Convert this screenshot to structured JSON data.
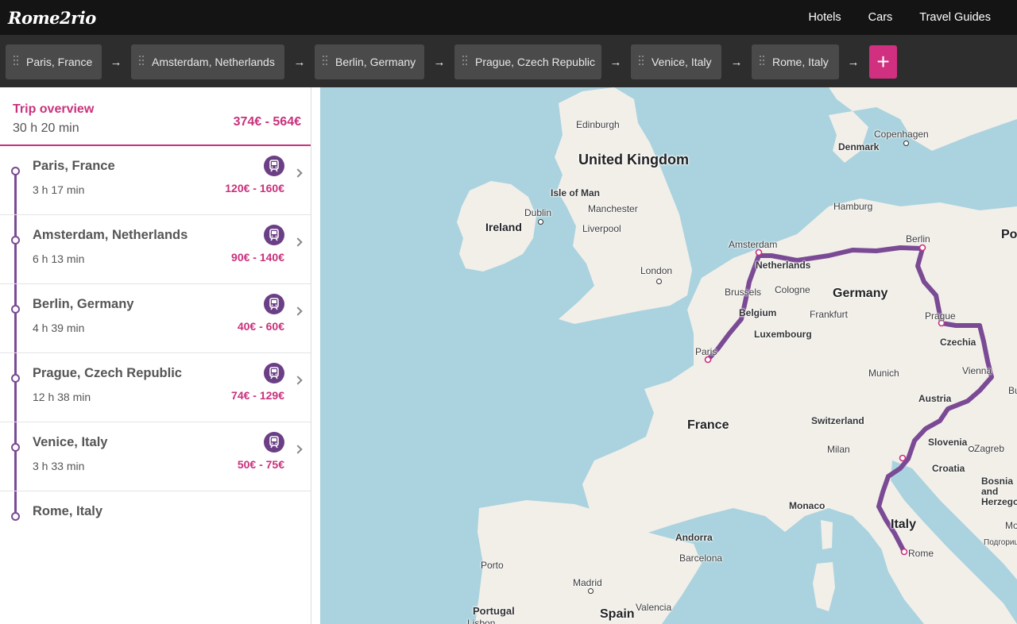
{
  "app": {
    "logo": "Rome2rio"
  },
  "nav": {
    "links": [
      "Hotels",
      "Cars",
      "Travel Guides"
    ]
  },
  "route_bar": {
    "stops": [
      "Paris, France",
      "Amsterdam, Netherlands",
      "Berlin, Germany",
      "Prague, Czech Republic",
      "Venice, Italy",
      "Rome, Italy"
    ],
    "arrow": "→",
    "add_label": "+"
  },
  "overview": {
    "title": "Trip overview",
    "duration": "30 h 20 min",
    "price": "374€ - 564€"
  },
  "segments": [
    {
      "city": "Paris, France",
      "duration": "3 h 17 min",
      "price": "120€ - 160€",
      "mode_icon": "train-icon"
    },
    {
      "city": "Amsterdam, Netherlands",
      "duration": "6 h 13 min",
      "price": "90€ - 140€",
      "mode_icon": "train-icon"
    },
    {
      "city": "Berlin, Germany",
      "duration": "4 h 39 min",
      "price": "40€ - 60€",
      "mode_icon": "train-icon"
    },
    {
      "city": "Prague, Czech Republic",
      "duration": "12 h 38 min",
      "price": "74€ - 129€",
      "mode_icon": "train-icon"
    },
    {
      "city": "Venice, Italy",
      "duration": "3 h 33 min",
      "price": "50€ - 75€",
      "mode_icon": "train-icon"
    }
  ],
  "final_stop": {
    "city": "Rome, Italy"
  },
  "map": {
    "countries": [
      "United Kingdom",
      "Ireland",
      "France",
      "Germany",
      "Italy",
      "Spain",
      "Portugal",
      "Denmark",
      "Czechia",
      "Austria",
      "Switzerland",
      "Slovenia",
      "Croatia",
      "Luxembourg",
      "Belgium",
      "Netherlands",
      "Andorra",
      "Monaco",
      "Bosnia and Herzegovina",
      "Po",
      "Bu",
      "Mo",
      "Подгорица"
    ],
    "cities": [
      "Edinburgh",
      "Isle of Man",
      "Dublin",
      "Manchester",
      "Liverpool",
      "London",
      "Copenhagen",
      "Hamburg",
      "Amsterdam",
      "Berlin",
      "Brussels",
      "Cologne",
      "Frankfurt",
      "Paris",
      "Prague",
      "Munich",
      "Vienna",
      "Milan",
      "Zagreb",
      "Barcelona",
      "Madrid",
      "Valencia",
      "Porto",
      "Rome",
      "Lisbon"
    ],
    "colors": {
      "water": "#aad3df",
      "land": "#f2efe9",
      "route": "#7a4a95",
      "accent": "#c9317c"
    }
  }
}
